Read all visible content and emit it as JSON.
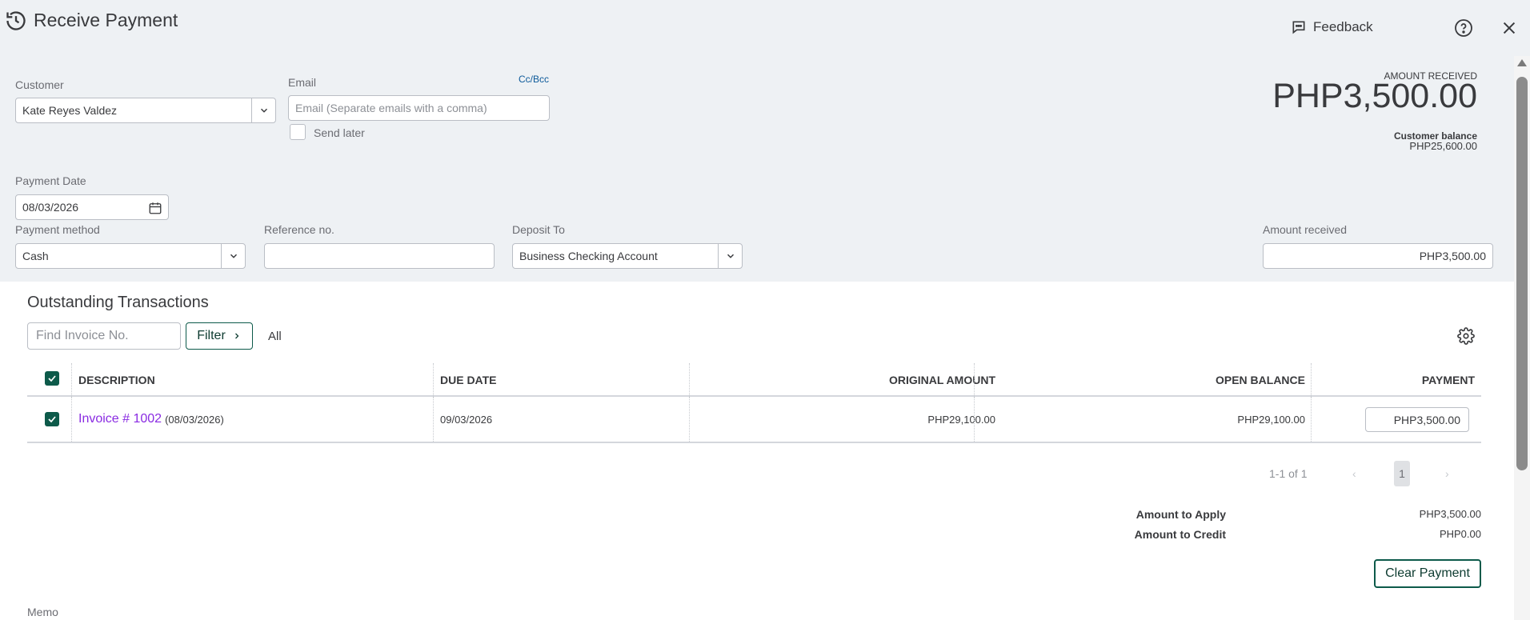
{
  "header": {
    "title": "Receive Payment",
    "feedback_label": "Feedback",
    "icons": [
      "history-icon",
      "feedback-icon",
      "help-icon",
      "close-icon"
    ]
  },
  "form": {
    "customer": {
      "label": "Customer",
      "value": "Kate Reyes Valdez"
    },
    "email": {
      "label": "Email",
      "placeholder": "Email (Separate emails with a comma)",
      "cc_bcc_label": "Cc/Bcc"
    },
    "send_later_label": "Send later",
    "payment_date": {
      "label": "Payment Date",
      "value": "08/03/2026"
    },
    "payment_method": {
      "label": "Payment method",
      "value": "Cash"
    },
    "reference_no": {
      "label": "Reference no.",
      "value": ""
    },
    "deposit_to": {
      "label": "Deposit To",
      "value": "Business Checking Account"
    },
    "amount_received": {
      "label": "Amount received",
      "value": "PHP3,500.00"
    }
  },
  "summary": {
    "amount_received_label": "AMOUNT RECEIVED",
    "amount_received_value": "PHP3,500.00",
    "customer_balance_label": "Customer balance",
    "customer_balance_value": "PHP25,600.00"
  },
  "outstanding": {
    "title": "Outstanding Transactions",
    "search_placeholder": "Find Invoice No.",
    "filter_label": "Filter",
    "filter_value": "All",
    "columns": [
      "DESCRIPTION",
      "DUE DATE",
      "ORIGINAL AMOUNT",
      "OPEN BALANCE",
      "PAYMENT"
    ],
    "rows": [
      {
        "checked": true,
        "invoice": "Invoice # 1002",
        "invoice_date": "(08/03/2026)",
        "due_date": "09/03/2026",
        "original_amount": "PHP29,100.00",
        "open_balance": "PHP29,100.00",
        "payment": "PHP3,500.00"
      }
    ],
    "pagination": {
      "range": "1-1 of 1",
      "current_page": "1",
      "prev": "‹",
      "next": "›"
    }
  },
  "totals": {
    "amount_to_apply_label": "Amount to Apply",
    "amount_to_apply_value": "PHP3,500.00",
    "amount_to_credit_label": "Amount to Credit",
    "amount_to_credit_value": "PHP0.00",
    "clear_payment_label": "Clear Payment"
  },
  "memo_label": "Memo",
  "colors": {
    "accent_green": "#0d5a4a",
    "link_purple": "#8a2be2",
    "panel_bg": "#eef1f4"
  }
}
